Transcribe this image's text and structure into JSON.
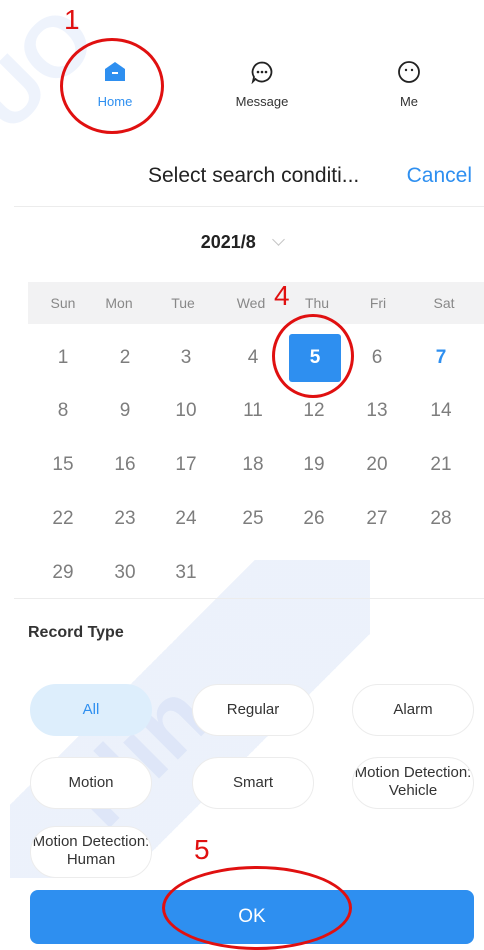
{
  "nav": {
    "home": {
      "label": "Home",
      "icon": "home-icon"
    },
    "message": {
      "label": "Message",
      "icon": "message-icon"
    },
    "me": {
      "label": "Me",
      "icon": "me-icon"
    }
  },
  "header": {
    "title": "Select search conditi...",
    "cancel": "Cancel"
  },
  "calendar": {
    "month": "2021/8",
    "weekdays": [
      "Sun",
      "Mon",
      "Tue",
      "Wed",
      "Thu",
      "Fri",
      "Sat"
    ],
    "weeks": [
      [
        "1",
        "2",
        "3",
        "4",
        "5",
        "6",
        "7"
      ],
      [
        "8",
        "9",
        "10",
        "11",
        "12",
        "13",
        "14"
      ],
      [
        "15",
        "16",
        "17",
        "18",
        "19",
        "20",
        "21"
      ],
      [
        "22",
        "23",
        "24",
        "25",
        "26",
        "27",
        "28"
      ],
      [
        "29",
        "30",
        "31",
        "",
        "",
        "",
        ""
      ]
    ],
    "selected_day": "5",
    "today_day": "7"
  },
  "record_type": {
    "label": "Record Type",
    "options": [
      "All",
      "Regular",
      "Alarm",
      "Motion",
      "Smart",
      "Motion Detection: Vehicle",
      "Motion Detection: Human"
    ],
    "selected": "All"
  },
  "ok_label": "OK",
  "annotations": [
    "1",
    "4",
    "5"
  ],
  "watermark": [
    "UO",
    "Hin"
  ],
  "colors": {
    "accent": "#2e8ff0",
    "chip_selected_bg": "#ddeefc",
    "annotation": "#e01010"
  }
}
